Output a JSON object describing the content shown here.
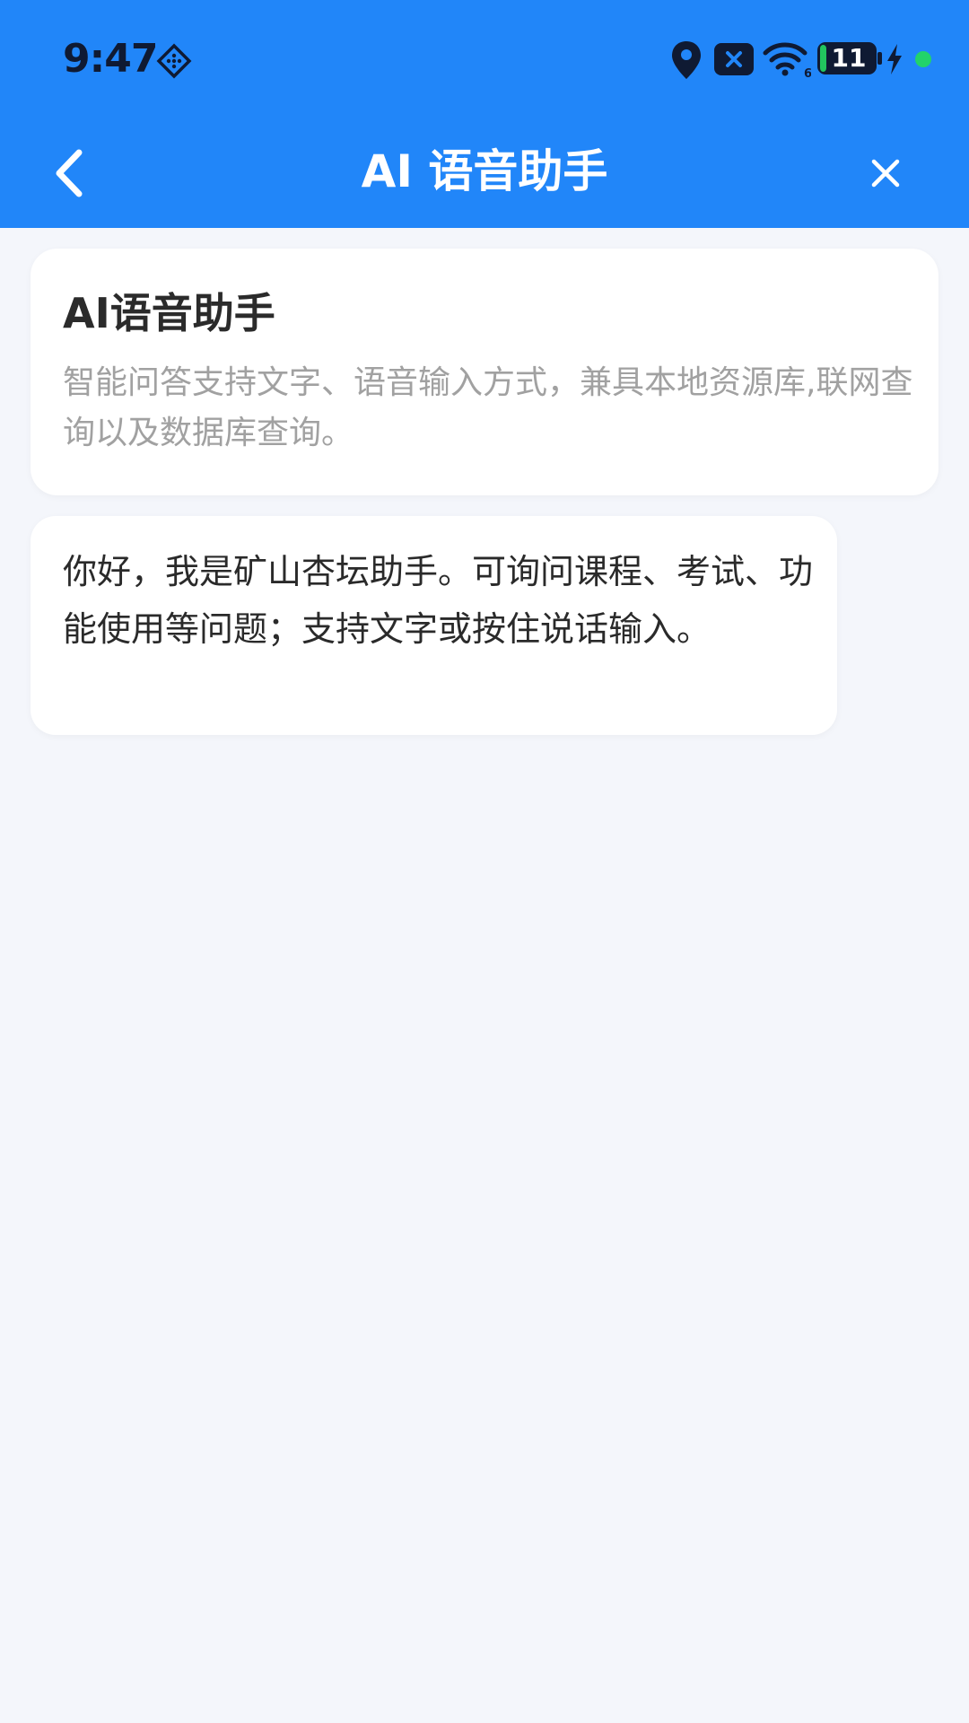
{
  "status_bar": {
    "time": "9:47",
    "battery_level": "11",
    "icons": [
      "nfc-diamond-icon",
      "location-pin-icon",
      "sim-off-icon",
      "wifi-6-icon",
      "battery-icon",
      "charging-bolt-icon",
      "privacy-dot-icon"
    ],
    "colors": {
      "icon_dark": "#0f1a33",
      "battery_fill": "#22c55e",
      "privacy_dot": "#22d36a"
    }
  },
  "nav_bar": {
    "title": "AI 语音助手",
    "back_icon": "chevron-left-icon",
    "close_icon": "close-icon"
  },
  "intro_card": {
    "title": "AI语音助手",
    "description": "智能问答支持文字、语音输入方式，兼具本地资源库,联网查询以及数据库查询。"
  },
  "messages": [
    {
      "role": "assistant",
      "text": "你好，我是矿山杏坛助手。可询问课程、考试、功能使用等问题；支持文字或按住说话输入。"
    }
  ],
  "theme": {
    "header_bg": "#2186f9",
    "page_bg": "#f4f6fb",
    "card_bg": "#ffffff",
    "title_text": "#2b2b2b",
    "muted_text": "#a1a1a1"
  }
}
